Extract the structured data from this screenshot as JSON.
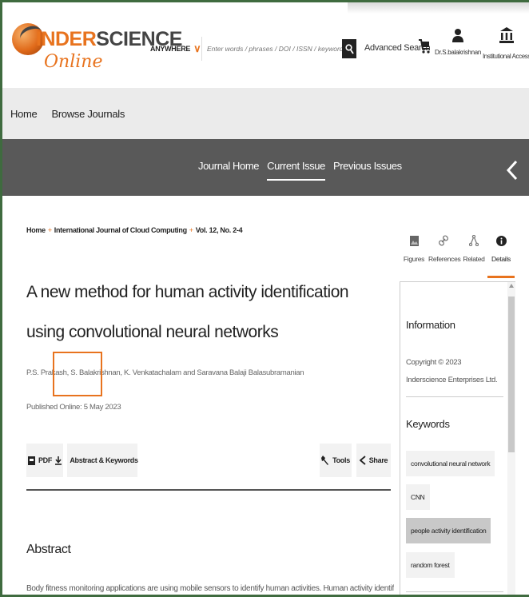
{
  "header": {
    "logo_brand_a": "INDER",
    "logo_brand_b": "SCIENCE",
    "logo_sub": "Online",
    "search": {
      "scope": "ANYWHERE",
      "placeholder": "Enter words / phrases / DOI / ISSN / keywords / authors etc"
    },
    "advanced_search": "Advanced Search",
    "user_name": "Dr.S.balakrishnan",
    "institutional_access": "Institutional Access"
  },
  "subnav": {
    "home": "Home",
    "browse": "Browse Journals"
  },
  "journal_nav": {
    "journal_home": "Journal Home",
    "current_issue": "Current Issue",
    "previous_issues": "Previous Issues"
  },
  "breadcrumb": {
    "home": "Home",
    "journal": "International Journal of Cloud Computing",
    "volume": "Vol. 12, No. 2-4",
    "separator": "+"
  },
  "article": {
    "title": "A new method for human activity identification using convolutional neural networks",
    "authors": "P.S. Prakash, S. Balakrishnan, K. Venkatachalam and Saravana Balaji Balasubramanian",
    "published": "Published Online: 5 May 2023"
  },
  "actions": {
    "pdf": "PDF",
    "abstract_keywords": "Abstract & Keywords",
    "tools": "Tools",
    "share": "Share"
  },
  "abstract": {
    "heading": "Abstract",
    "text": "Body fitness monitoring applications are using mobile sensors to identify human activities. Human activity identification is a"
  },
  "side_tabs": {
    "figures": "Figures",
    "references": "References",
    "related": "Related",
    "details": "Details"
  },
  "details_panel": {
    "info_heading": "Information",
    "copyright": "Copyright © 2023 Inderscience Enterprises Ltd.",
    "keywords_heading": "Keywords",
    "keywords": [
      "convolutional neural network",
      "CNN",
      "people activity identification",
      "random forest"
    ]
  },
  "colors": {
    "accent": "#e8731e",
    "dark_bar": "#595959",
    "subnav_bg": "#ebebeb"
  }
}
